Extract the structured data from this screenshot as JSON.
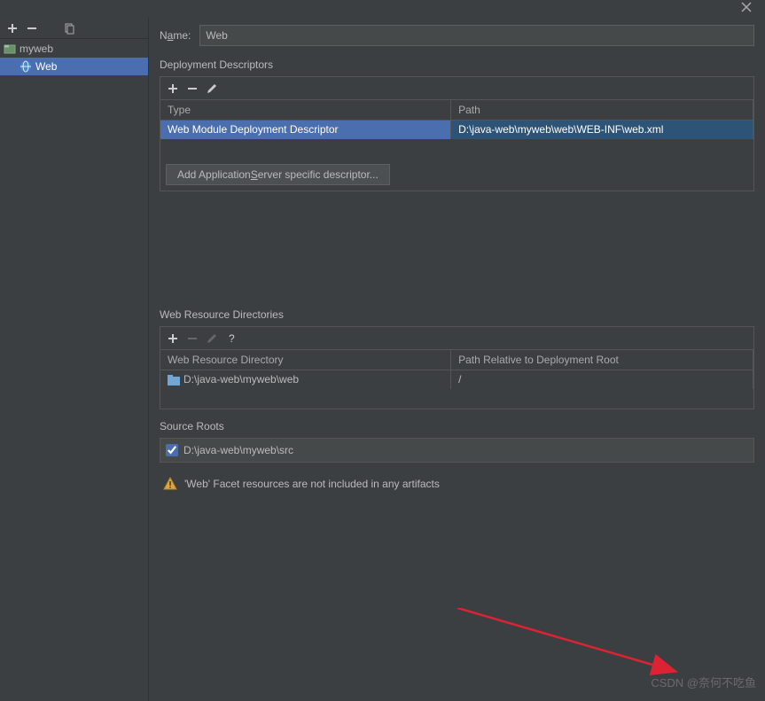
{
  "titlebar": {
    "close": "×"
  },
  "sidebar": {
    "toolbar": {
      "add": "+",
      "remove": "−",
      "copy": "copy"
    },
    "tree": [
      {
        "label": "myweb",
        "kind": "folder",
        "indent": 0
      },
      {
        "label": "Web",
        "kind": "web",
        "indent": 1,
        "selected": true
      }
    ]
  },
  "content": {
    "name_label": "Name:",
    "name_value": "Web",
    "dd_section": "Deployment Descriptors",
    "dd_headers": {
      "type": "Type",
      "path": "Path"
    },
    "dd_rows": [
      {
        "type": "Web Module Deployment Descriptor",
        "path": "D:\\java-web\\myweb\\web\\WEB-INF\\web.xml",
        "selected": true
      }
    ],
    "add_server_btn": "Add Application Server specific descriptor...",
    "wrd_section": "Web Resource Directories",
    "wrd_headers": {
      "dir": "Web Resource Directory",
      "rel": "Path Relative to Deployment Root"
    },
    "wrd_rows": [
      {
        "dir": "D:\\java-web\\myweb\\web",
        "rel": "/"
      }
    ],
    "sr_section": "Source Roots",
    "sr_item": "D:\\java-web\\myweb\\src",
    "sr_checked": true,
    "warning": "'Web' Facet resources are not included in any artifacts"
  },
  "watermark": "CSDN @奈何不吃鱼"
}
